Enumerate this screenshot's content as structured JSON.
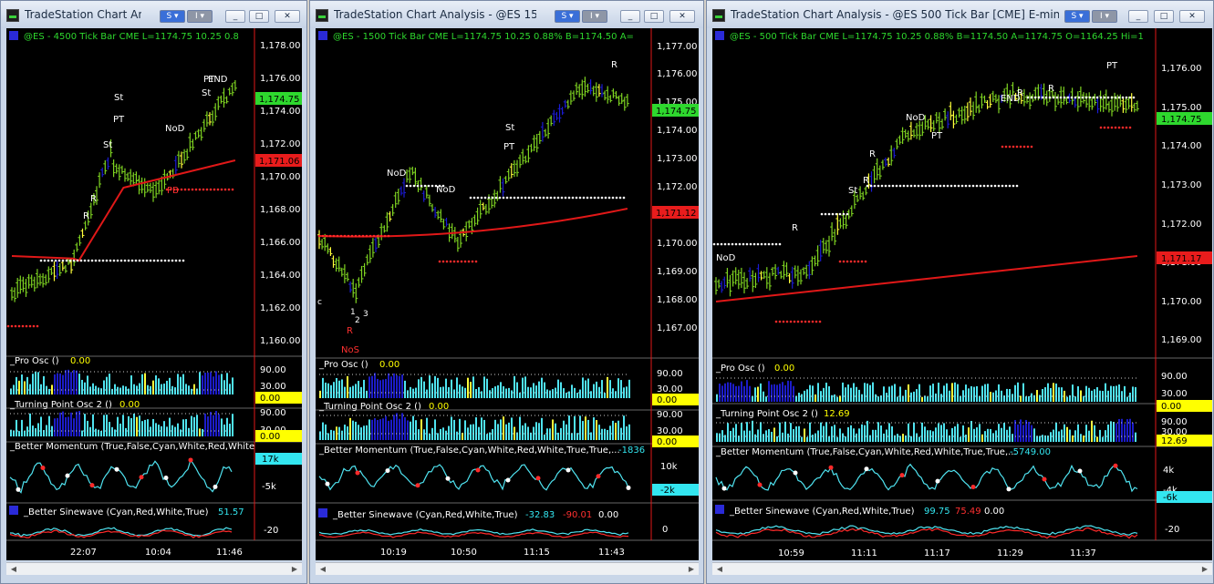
{
  "windows": [
    {
      "title": "TradeStation Chart An...",
      "btn_s": "S ▾",
      "btn_i": "I ▾",
      "caption_buttons": [
        "_",
        "□",
        "✕"
      ],
      "header": {
        "symbol": "@ES - 4500 Tick Bar  CME  L=1174.75  10.25  0.8",
        "price_tag": "1,174.75",
        "ma_tag": "1,171.06"
      },
      "price_axis": [
        "1,178.00",
        "1,176.00",
        "1,174.00",
        "1,172.00",
        "1,170.00",
        "1,168.00",
        "1,166.00",
        "1,164.00",
        "1,162.00",
        "1,160.00"
      ],
      "annotations": [
        "St",
        "PT",
        "St",
        "NoD",
        "R",
        "R",
        "PB",
        "St",
        "PT",
        "END"
      ],
      "pro_osc": {
        "label": "_Pro Osc ()",
        "value": "0.00",
        "axis": [
          "90.00",
          "30.00"
        ],
        "tag": "0.00"
      },
      "tp_osc": {
        "label": "_Turning Point Osc 2 ()",
        "value": "0.00",
        "axis": [
          "90.00",
          "30.00"
        ],
        "tag": "0.00"
      },
      "momentum": {
        "label": "_Better Momentum (True,False,Cyan,White,Red,White",
        "value": "",
        "axis": [
          "17k",
          "-5k"
        ],
        "tag": "17k"
      },
      "sinewave": {
        "label": "_Better Sinewave (Cyan,Red,White,True)",
        "v1": "51.57",
        "v2": "",
        "v3": "",
        "axis": [
          "-20"
        ]
      },
      "time_axis": [
        "22:07",
        "10:04",
        "11:46"
      ]
    },
    {
      "title": "TradeStation Chart Analysis - @ES 1500 ...",
      "btn_s": "S ▾",
      "btn_i": "I ▾",
      "caption_buttons": [
        "_",
        "□",
        "✕"
      ],
      "header": {
        "symbol": "@ES - 1500 Tick Bar  CME  L=1174.75  10.25  0.88%  B=1174.50  A=",
        "price_tag": "1,174.75",
        "ma_tag": "1,171.12"
      },
      "price_axis": [
        "1,177.00",
        "1,176.00",
        "1,175.00",
        "1,174.00",
        "1,173.00",
        "1,172.00",
        "1,171.00",
        "1,170.00",
        "1,169.00",
        "1,168.00",
        "1,167.00"
      ],
      "annotations": [
        "NoD",
        "NoD",
        "St",
        "PT",
        "R",
        "c",
        "1",
        "2",
        "3",
        "R",
        "NoS"
      ],
      "pro_osc": {
        "label": "_Pro Osc ()",
        "value": "0.00",
        "axis": [
          "90.00",
          "30.00"
        ],
        "tag": "0.00"
      },
      "tp_osc": {
        "label": "_Turning Point Osc 2 ()",
        "value": "0.00",
        "axis": [
          "90.00",
          "30.00"
        ],
        "tag": "0.00"
      },
      "momentum": {
        "label": "_Better Momentum (True,False,Cyan,White,Red,White,True,True,...",
        "value": "-1836",
        "axis": [
          "10k",
          "0"
        ],
        "tag": "-2k"
      },
      "sinewave": {
        "label": "_Better Sinewave (Cyan,Red,White,True)",
        "v1": "-32.83",
        "v2": "-90.01",
        "v3": "0.00",
        "axis": [
          "0"
        ]
      },
      "time_axis": [
        "10:19",
        "10:50",
        "11:15",
        "11:43"
      ]
    },
    {
      "title": "TradeStation Chart Analysis - @ES 500 Tick Bar [CME] E-mini S&...",
      "btn_s": "S ▾",
      "btn_i": "I ▾",
      "caption_buttons": [
        "_",
        "□",
        "✕"
      ],
      "header": {
        "symbol": "@ES - 500 Tick Bar  CME  L=1174.75  10.25  0.88%  B=1174.50  A=1174.75  O=1164.25  Hi=1",
        "price_tag": "1,174.75",
        "ma_tag": "1,171.17"
      },
      "price_axis": [
        "1,176.00",
        "1,175.00",
        "1,174.00",
        "1,173.00",
        "1,172.00",
        "1,171.00",
        "1,170.00",
        "1,169.00"
      ],
      "annotations": [
        "NoD",
        "R",
        "St",
        "R",
        "R",
        "NoD",
        "PT",
        "END",
        "R",
        "PT",
        "R"
      ],
      "pro_osc": {
        "label": "_Pro Osc ()",
        "value": "0.00",
        "axis": [
          "90.00",
          "30.00"
        ],
        "tag": "0.00"
      },
      "tp_osc": {
        "label": "_Turning Point Osc 2 ()",
        "value": "12.69",
        "axis": [
          "90.00",
          "30.00"
        ],
        "tag": "12.69"
      },
      "momentum": {
        "label": "_Better Momentum (True,False,Cyan,White,Red,White,True,True,...",
        "value": "-5749.00",
        "axis": [
          "4k",
          "-4k"
        ],
        "tag": "-6k"
      },
      "sinewave": {
        "label": "_Better Sinewave (Cyan,Red,White,True)",
        "v1": "99.75",
        "v2": "75.49",
        "v3": "0.00",
        "axis": [
          "-20"
        ]
      },
      "time_axis": [
        "10:59",
        "11:11",
        "11:17",
        "11:29",
        "11:37"
      ]
    }
  ],
  "colors": {
    "bull_bar": "#7ed321",
    "strong_bar": "#1b1bd6",
    "warn_bar": "#ffff3a",
    "ma_line": "#e01818",
    "support_dots": "#ffffff",
    "resist_dots": "#ff2a2a",
    "cyan": "#4fe3f0",
    "label_text": "#ffffff",
    "value_yellow": "#ffff00",
    "tag_green": "#2ed82e",
    "tag_red": "#e81c1c",
    "tag_yellow": "#ffff00",
    "tag_cyan": "#33e6f0"
  }
}
